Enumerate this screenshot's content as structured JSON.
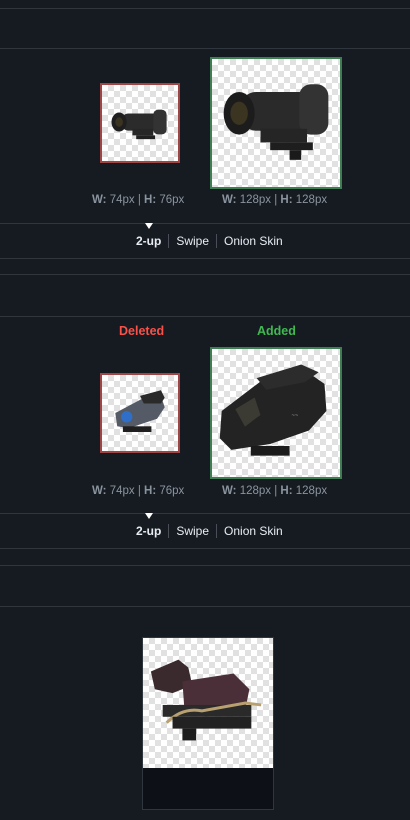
{
  "diffs": [
    {
      "deleted_dims": {
        "w_label": "W:",
        "w_value": "74px",
        "h_label": "H:",
        "h_value": "76px"
      },
      "added_dims": {
        "w_label": "W:",
        "w_value": "128px",
        "h_label": "H:",
        "h_value": "128px"
      },
      "tabs": [
        "2-up",
        "Swipe",
        "Onion Skin"
      ],
      "active_tab": "2-up"
    },
    {
      "deleted_label": "Deleted",
      "added_label": "Added",
      "deleted_dims": {
        "w_label": "W:",
        "w_value": "74px",
        "h_label": "H:",
        "h_value": "76px"
      },
      "added_dims": {
        "w_label": "W:",
        "w_value": "128px",
        "h_label": "H:",
        "h_value": "128px"
      },
      "tabs": [
        "2-up",
        "Swipe",
        "Onion Skin"
      ],
      "active_tab": "2-up"
    }
  ],
  "colors": {
    "deleted": "#f85149",
    "added": "#3fb950",
    "background": "#161b22"
  }
}
